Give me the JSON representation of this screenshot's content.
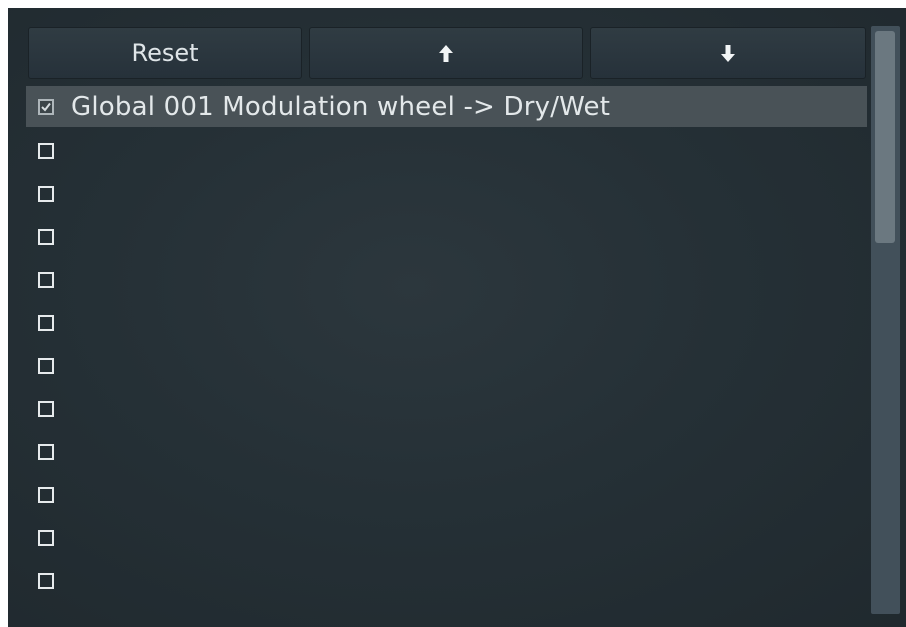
{
  "toolbar": {
    "reset_label": "Reset",
    "up_icon": "arrow-up-icon",
    "down_icon": "arrow-down-icon"
  },
  "list": {
    "items": [
      {
        "label": "Global 001 Modulation wheel -> Dry/Wet",
        "checked": true,
        "selected": true
      },
      {
        "label": "",
        "checked": false
      },
      {
        "label": "",
        "checked": false
      },
      {
        "label": "",
        "checked": false
      },
      {
        "label": "",
        "checked": false
      },
      {
        "label": "",
        "checked": false
      },
      {
        "label": "",
        "checked": false
      },
      {
        "label": "",
        "checked": false
      },
      {
        "label": "",
        "checked": false
      },
      {
        "label": "",
        "checked": false
      },
      {
        "label": "",
        "checked": false
      },
      {
        "label": "",
        "checked": false
      }
    ]
  },
  "colors": {
    "panel_bg": "#253036",
    "selected_row": "#495257",
    "text": "#e3e8ea",
    "scrollbar_track": "#42505a",
    "scrollbar_thumb": "#6b7880"
  }
}
